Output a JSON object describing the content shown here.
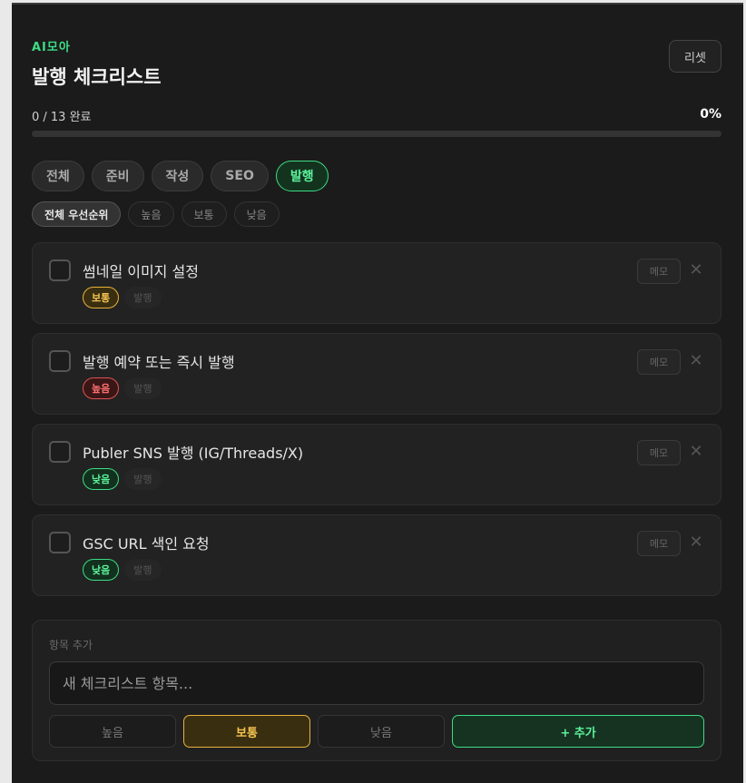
{
  "header": {
    "brand": "AI모아",
    "title": "발행 체크리스트",
    "reset_label": "리셋"
  },
  "progress": {
    "text": "0 / 13 완료",
    "percent_label": "0%",
    "fraction": 0
  },
  "category_filters": [
    {
      "label": "전체",
      "active": false
    },
    {
      "label": "준비",
      "active": false
    },
    {
      "label": "작성",
      "active": false
    },
    {
      "label": "SEO",
      "active": false
    },
    {
      "label": "발행",
      "active": true
    }
  ],
  "priority_filters": [
    {
      "label": "전체 우선순위",
      "active": true
    },
    {
      "label": "높음",
      "active": false
    },
    {
      "label": "보통",
      "active": false
    },
    {
      "label": "낮음",
      "active": false
    }
  ],
  "items": [
    {
      "text": "썸네일 이미지 설정",
      "priority": "보통",
      "priority_level": "mid",
      "category": "발행",
      "memo_label": "메모",
      "delete_icon": "close-icon"
    },
    {
      "text": "발행 예약 또는 즉시 발행",
      "priority": "높음",
      "priority_level": "high",
      "category": "발행",
      "memo_label": "메모",
      "delete_icon": "close-icon"
    },
    {
      "text": "Publer SNS 발행 (IG/Threads/X)",
      "priority": "낮음",
      "priority_level": "low",
      "category": "발행",
      "memo_label": "메모",
      "delete_icon": "close-icon"
    },
    {
      "text": "GSC URL 색인 요청",
      "priority": "낮음",
      "priority_level": "low",
      "category": "발행",
      "memo_label": "메모",
      "delete_icon": "close-icon"
    }
  ],
  "add_panel": {
    "label": "항목 추가",
    "placeholder": "새 체크리스트 항목...",
    "priority_options": [
      {
        "label": "높음",
        "active": false
      },
      {
        "label": "보통",
        "active": true
      },
      {
        "label": "낮음",
        "active": false
      }
    ],
    "add_label": "+ 추가"
  },
  "colors": {
    "accent": "#3ddc84",
    "mid": "#e8b339",
    "high": "#e05252",
    "background": "#1b1b1b"
  }
}
